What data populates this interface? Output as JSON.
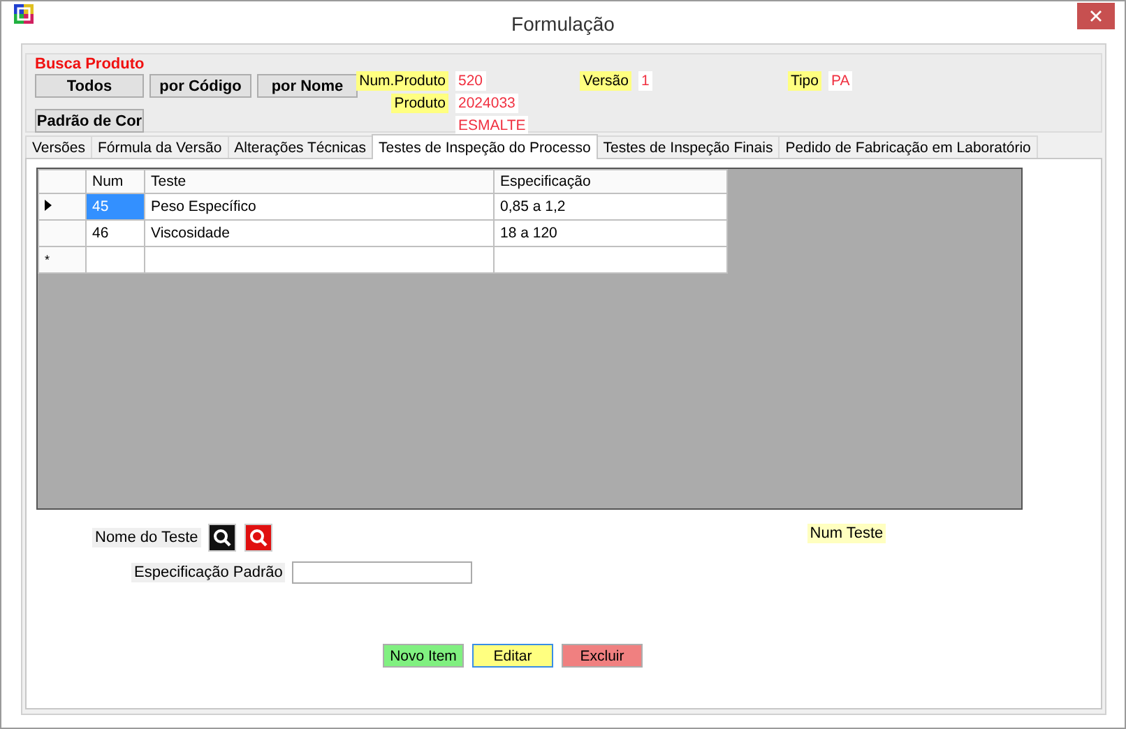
{
  "window": {
    "title": "Formulação"
  },
  "product_search": {
    "title": "Busca Produto",
    "buttons": [
      "Todos",
      "por Código",
      "por Nome",
      "Padrão de Cor"
    ]
  },
  "product_info": {
    "num_produto": {
      "label": "Num.Produto",
      "value": "520"
    },
    "versao": {
      "label": "Versão",
      "value": "1"
    },
    "tipo": {
      "label": "Tipo",
      "value": "PA"
    },
    "produto": {
      "label": "Produto",
      "value": "2024033"
    },
    "descricao": {
      "value": "ESMALTE"
    }
  },
  "tabs": [
    {
      "label": "Versões",
      "selected": false
    },
    {
      "label": "Fórmula da Versão",
      "selected": false
    },
    {
      "label": "Alterações Técnicas",
      "selected": false
    },
    {
      "label": "Testes de Inspeção do Processo",
      "selected": true
    },
    {
      "label": "Testes de Inspeção Finais",
      "selected": false
    },
    {
      "label": "Pedido de Fabricação em Laboratório",
      "selected": false
    }
  ],
  "grid": {
    "columns": [
      "Num",
      "Teste",
      "Especificação"
    ],
    "rows": [
      {
        "selected": true,
        "cells": [
          "45",
          "Peso Específico",
          "0,85 a 1,2"
        ]
      },
      {
        "selected": false,
        "cells": [
          "46",
          "Viscosidade",
          "18 a 120"
        ]
      }
    ],
    "new_row_marker": "*"
  },
  "test_name": {
    "label": "Nome do Teste"
  },
  "num_test": {
    "label": "Num Teste"
  },
  "spec": {
    "label": "Especificação Padrão"
  },
  "actions": [
    {
      "label": "Novo Item",
      "color": "#80f080",
      "focused": false
    },
    {
      "label": "Editar",
      "color": "#ffff80",
      "focused": true
    },
    {
      "label": "Excluir",
      "color": "#f08080",
      "focused": false
    }
  ]
}
